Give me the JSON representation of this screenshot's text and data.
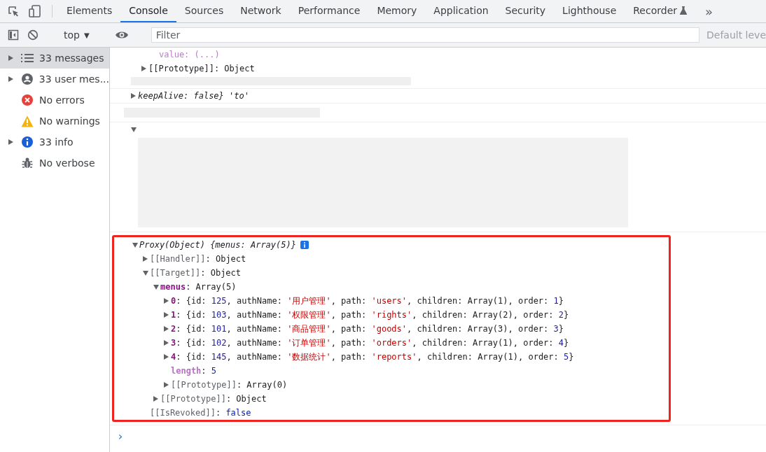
{
  "tabs": [
    {
      "label": "Elements",
      "selected": false
    },
    {
      "label": "Console",
      "selected": true
    },
    {
      "label": "Sources",
      "selected": false
    },
    {
      "label": "Network",
      "selected": false
    },
    {
      "label": "Performance",
      "selected": false
    },
    {
      "label": "Memory",
      "selected": false
    },
    {
      "label": "Application",
      "selected": false
    },
    {
      "label": "Security",
      "selected": false
    },
    {
      "label": "Lighthouse",
      "selected": false
    },
    {
      "label": "Recorder",
      "selected": false,
      "experimental": true
    }
  ],
  "more_tabs": "»",
  "toolbar": {
    "context": "top",
    "context_caret": "▼",
    "filter": {
      "placeholder": "Filter"
    },
    "levels": "Default leve"
  },
  "sidebar": {
    "items": [
      {
        "kind": "messages",
        "label": "33 messages",
        "selected": true,
        "expandable": true
      },
      {
        "kind": "user",
        "label": "33 user mes...",
        "selected": false,
        "expandable": true
      },
      {
        "kind": "errors",
        "label": "No errors",
        "selected": false,
        "expandable": false
      },
      {
        "kind": "warnings",
        "label": "No warnings",
        "selected": false,
        "expandable": false
      },
      {
        "kind": "info",
        "label": "33 info",
        "selected": false,
        "expandable": true
      },
      {
        "kind": "verbose",
        "label": "No verbose",
        "selected": false,
        "expandable": false
      }
    ]
  },
  "earlier_messages": [
    {
      "kind": "partial",
      "lines": [
        {
          "kind": "meta",
          "text": "value: (...)",
          "expandable": false
        },
        {
          "kind": "internal",
          "text": "[[Prototype]]: Object",
          "expandable": true,
          "expanded": false
        }
      ]
    },
    {
      "kind": "plain",
      "lines": [
        {
          "kind": "top",
          "text": "keepAlive: false} 'to'",
          "expandable": true,
          "expanded": false
        }
      ]
    },
    {
      "kind": "hidden"
    },
    {
      "kind": "array",
      "lines": [
        {
          "kind": "top",
          "expandable": true,
          "expanded": true
        }
      ]
    }
  ],
  "proxy": {
    "summary": "Proxy(Object) {menus: Array(5)}",
    "expanded": true,
    "highlighted": true,
    "children": [
      {
        "key": "[[Handler]]",
        "kind": "internal",
        "expandable": true,
        "expanded": false,
        "value": [
          {
            "kind": "plain",
            "text": ": Object"
          }
        ]
      },
      {
        "key": "[[Target]]",
        "kind": "internal",
        "expandable": true,
        "expanded": true,
        "value": [
          {
            "kind": "plain",
            "text": ": Object"
          }
        ],
        "children": [
          {
            "key": "menus",
            "kind": "prop",
            "expandable": true,
            "expanded": true,
            "value": [
              {
                "kind": "plain",
                "text": ": Array(5)"
              }
            ],
            "children": [
              {
                "key": "0",
                "kind": "prop",
                "expandable": true,
                "expanded": false,
                "value": [
                  {
                    "kind": "plain",
                    "text": ": {id: "
                  },
                  {
                    "kind": "num",
                    "text": "125"
                  },
                  {
                    "kind": "plain",
                    "text": ", authName: "
                  },
                  {
                    "kind": "str",
                    "text": "'用户管理'"
                  },
                  {
                    "kind": "plain",
                    "text": ", path: "
                  },
                  {
                    "kind": "str",
                    "text": "'users'"
                  },
                  {
                    "kind": "plain",
                    "text": ", children: Array(1), order: "
                  },
                  {
                    "kind": "num",
                    "text": "1"
                  },
                  {
                    "kind": "plain",
                    "text": "}"
                  }
                ]
              },
              {
                "key": "1",
                "kind": "prop",
                "expandable": true,
                "expanded": false,
                "value": [
                  {
                    "kind": "plain",
                    "text": ": {id: "
                  },
                  {
                    "kind": "num",
                    "text": "103"
                  },
                  {
                    "kind": "plain",
                    "text": ", authName: "
                  },
                  {
                    "kind": "str",
                    "text": "'权限管理'"
                  },
                  {
                    "kind": "plain",
                    "text": ", path: "
                  },
                  {
                    "kind": "str",
                    "text": "'rights'"
                  },
                  {
                    "kind": "plain",
                    "text": ", children: Array(2), order: "
                  },
                  {
                    "kind": "num",
                    "text": "2"
                  },
                  {
                    "kind": "plain",
                    "text": "}"
                  }
                ]
              },
              {
                "key": "2",
                "kind": "prop",
                "expandable": true,
                "expanded": false,
                "value": [
                  {
                    "kind": "plain",
                    "text": ": {id: "
                  },
                  {
                    "kind": "num",
                    "text": "101"
                  },
                  {
                    "kind": "plain",
                    "text": ", authName: "
                  },
                  {
                    "kind": "str",
                    "text": "'商品管理'"
                  },
                  {
                    "kind": "plain",
                    "text": ", path: "
                  },
                  {
                    "kind": "str",
                    "text": "'goods'"
                  },
                  {
                    "kind": "plain",
                    "text": ", children: Array(3), order: "
                  },
                  {
                    "kind": "num",
                    "text": "3"
                  },
                  {
                    "kind": "plain",
                    "text": "}"
                  }
                ]
              },
              {
                "key": "3",
                "kind": "prop",
                "expandable": true,
                "expanded": false,
                "value": [
                  {
                    "kind": "plain",
                    "text": ": {id: "
                  },
                  {
                    "kind": "num",
                    "text": "102"
                  },
                  {
                    "kind": "plain",
                    "text": ", authName: "
                  },
                  {
                    "kind": "str",
                    "text": "'订单管理'"
                  },
                  {
                    "kind": "plain",
                    "text": ", path: "
                  },
                  {
                    "kind": "str",
                    "text": "'orders'"
                  },
                  {
                    "kind": "plain",
                    "text": ", children: Array(1), order: "
                  },
                  {
                    "kind": "num",
                    "text": "4"
                  },
                  {
                    "kind": "plain",
                    "text": "}"
                  }
                ]
              },
              {
                "key": "4",
                "kind": "prop",
                "expandable": true,
                "expanded": false,
                "value": [
                  {
                    "kind": "plain",
                    "text": ": {id: "
                  },
                  {
                    "kind": "num",
                    "text": "145"
                  },
                  {
                    "kind": "plain",
                    "text": ", authName: "
                  },
                  {
                    "kind": "str",
                    "text": "'数据统计'"
                  },
                  {
                    "kind": "plain",
                    "text": ", path: "
                  },
                  {
                    "kind": "str",
                    "text": "'reports'"
                  },
                  {
                    "kind": "plain",
                    "text": ", children: Array(1), order: "
                  },
                  {
                    "kind": "num",
                    "text": "5"
                  },
                  {
                    "kind": "plain",
                    "text": "}"
                  }
                ]
              },
              {
                "key": "length",
                "kind": "meta",
                "expandable": false,
                "value": [
                  {
                    "kind": "plain",
                    "text": ": "
                  },
                  {
                    "kind": "num",
                    "text": "5"
                  }
                ]
              },
              {
                "key": "[[Prototype]]",
                "kind": "internal",
                "expandable": true,
                "expanded": false,
                "value": [
                  {
                    "kind": "plain",
                    "text": ": Array(0)"
                  }
                ]
              }
            ]
          },
          {
            "key": "[[Prototype]]",
            "kind": "internal",
            "expandable": true,
            "expanded": false,
            "value": [
              {
                "kind": "plain",
                "text": ": Object"
              }
            ]
          }
        ]
      },
      {
        "key": "[[IsRevoked]]",
        "kind": "internal",
        "expandable": false,
        "value": [
          {
            "kind": "plain",
            "text": ": "
          },
          {
            "kind": "kw",
            "text": "false"
          }
        ]
      }
    ]
  },
  "prompt": "›"
}
